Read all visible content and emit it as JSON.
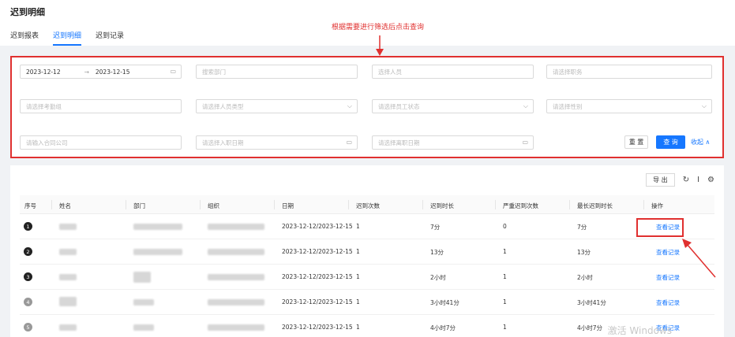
{
  "page": {
    "title": "迟到明细",
    "tabs": [
      {
        "label": "迟到报表",
        "active": false
      },
      {
        "label": "迟到明细",
        "active": true
      },
      {
        "label": "迟到记录",
        "active": false
      }
    ]
  },
  "annotation": {
    "text": "根据需要进行筛选后点击查询",
    "color": "#e0302f"
  },
  "filters": {
    "date_start": "2023-12-12",
    "date_sep": "→",
    "date_end": "2023-12-15",
    "dept_placeholder": "搜索部门",
    "person_placeholder": "选择人员",
    "position_placeholder": "请选择职务",
    "attendance_group_placeholder": "请选择考勤组",
    "person_type_placeholder": "请选择人员类型",
    "employee_status_placeholder": "请选择员工状态",
    "gender_placeholder": "请选择性别",
    "contract_company_placeholder": "请输入合同公司",
    "entry_date_placeholder": "请选择入职日期",
    "leave_date_placeholder": "请选择离职日期",
    "reset_label": "重 置",
    "query_label": "查 询",
    "collapse_label": "收起 ∧"
  },
  "toolbar": {
    "export_label": "导 出"
  },
  "table": {
    "headers": [
      "序号",
      "姓名",
      "部门",
      "组织",
      "日期",
      "迟到次数",
      "迟到时长",
      "严重迟到次数",
      "最长迟到时长",
      "操作"
    ],
    "rows": [
      {
        "index": "1",
        "date": "2023-12-12/2023-12-15",
        "late_count": "1",
        "late_duration": "7分",
        "severe_count": "0",
        "max_duration": "7分",
        "action": "查看记录",
        "badge_color": "#222"
      },
      {
        "index": "2",
        "date": "2023-12-12/2023-12-15",
        "late_count": "1",
        "late_duration": "13分",
        "severe_count": "1",
        "max_duration": "13分",
        "action": "查看记录",
        "badge_color": "#222"
      },
      {
        "index": "3",
        "date": "2023-12-12/2023-12-15",
        "late_count": "1",
        "late_duration": "2小时",
        "severe_count": "1",
        "max_duration": "2小时",
        "action": "查看记录",
        "badge_color": "#222"
      },
      {
        "index": "4",
        "date": "2023-12-12/2023-12-15",
        "late_count": "1",
        "late_duration": "3小时41分",
        "severe_count": "1",
        "max_duration": "3小时41分",
        "action": "查看记录",
        "badge_color": "#999"
      },
      {
        "index": "5",
        "date": "2023-12-12/2023-12-15",
        "late_count": "1",
        "late_duration": "4小时7分",
        "severe_count": "1",
        "max_duration": "4小时7分",
        "action": "查看记录",
        "badge_color": "#999"
      }
    ]
  },
  "overlay": {
    "windows_text": "激活 Windows"
  }
}
